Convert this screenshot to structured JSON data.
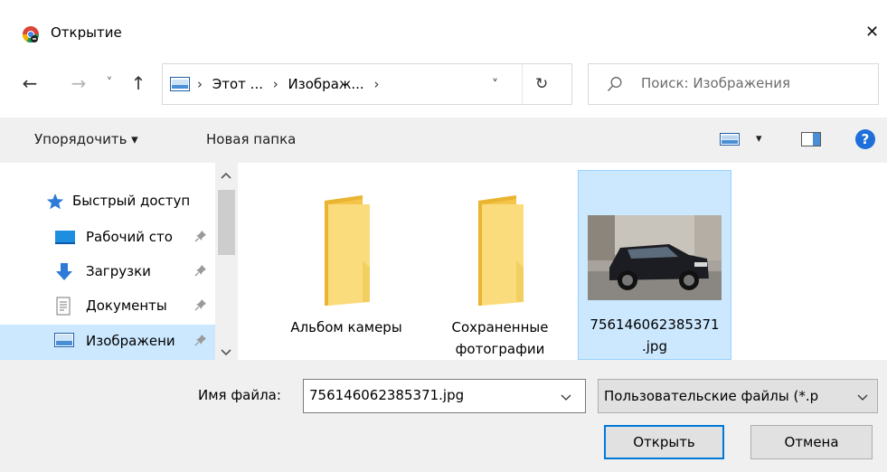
{
  "window": {
    "title": "Открытие",
    "close_glyph": "✕"
  },
  "nav": {
    "back_glyph": "←",
    "forward_glyph": "→",
    "recent_glyph": "˅",
    "up_glyph": "↑"
  },
  "address": {
    "crumbs": [
      "Этот ...",
      "Изображ..."
    ],
    "separator": "›",
    "dropdown_glyph": "˅",
    "refresh_glyph": "↻"
  },
  "search": {
    "placeholder": "Поиск: Изображения"
  },
  "toolbar": {
    "organize_label": "Упорядочить ▾",
    "new_folder_label": "Новая папка",
    "view_dropdown_glyph": "▾",
    "help_glyph": "?"
  },
  "sidebar": {
    "items": [
      {
        "label": "Быстрый доступ",
        "icon": "star-icon"
      },
      {
        "label": "Рабочий сто",
        "icon": "desktop-icon"
      },
      {
        "label": "Загрузки",
        "icon": "download-icon"
      },
      {
        "label": "Документы",
        "icon": "documents-icon"
      },
      {
        "label": "Изображени",
        "icon": "pictures-icon"
      }
    ]
  },
  "files": [
    {
      "name": "Альбом камеры",
      "type": "folder"
    },
    {
      "name": "Сохраненные фотографии",
      "type": "folder"
    },
    {
      "name": "756146062385371 .jpg",
      "type": "image"
    }
  ],
  "footer": {
    "filename_label": "Имя файла:",
    "filename_value": "756146062385371.jpg",
    "filter_value": "Пользовательские файлы (*.p",
    "open_label": "Открыть",
    "cancel_label": "Отмена"
  },
  "colors": {
    "selection": "#cce8ff",
    "selection_border": "#99d1ff",
    "accent": "#0078d7",
    "folder": "#f8d775",
    "help": "#1e6fd9"
  }
}
